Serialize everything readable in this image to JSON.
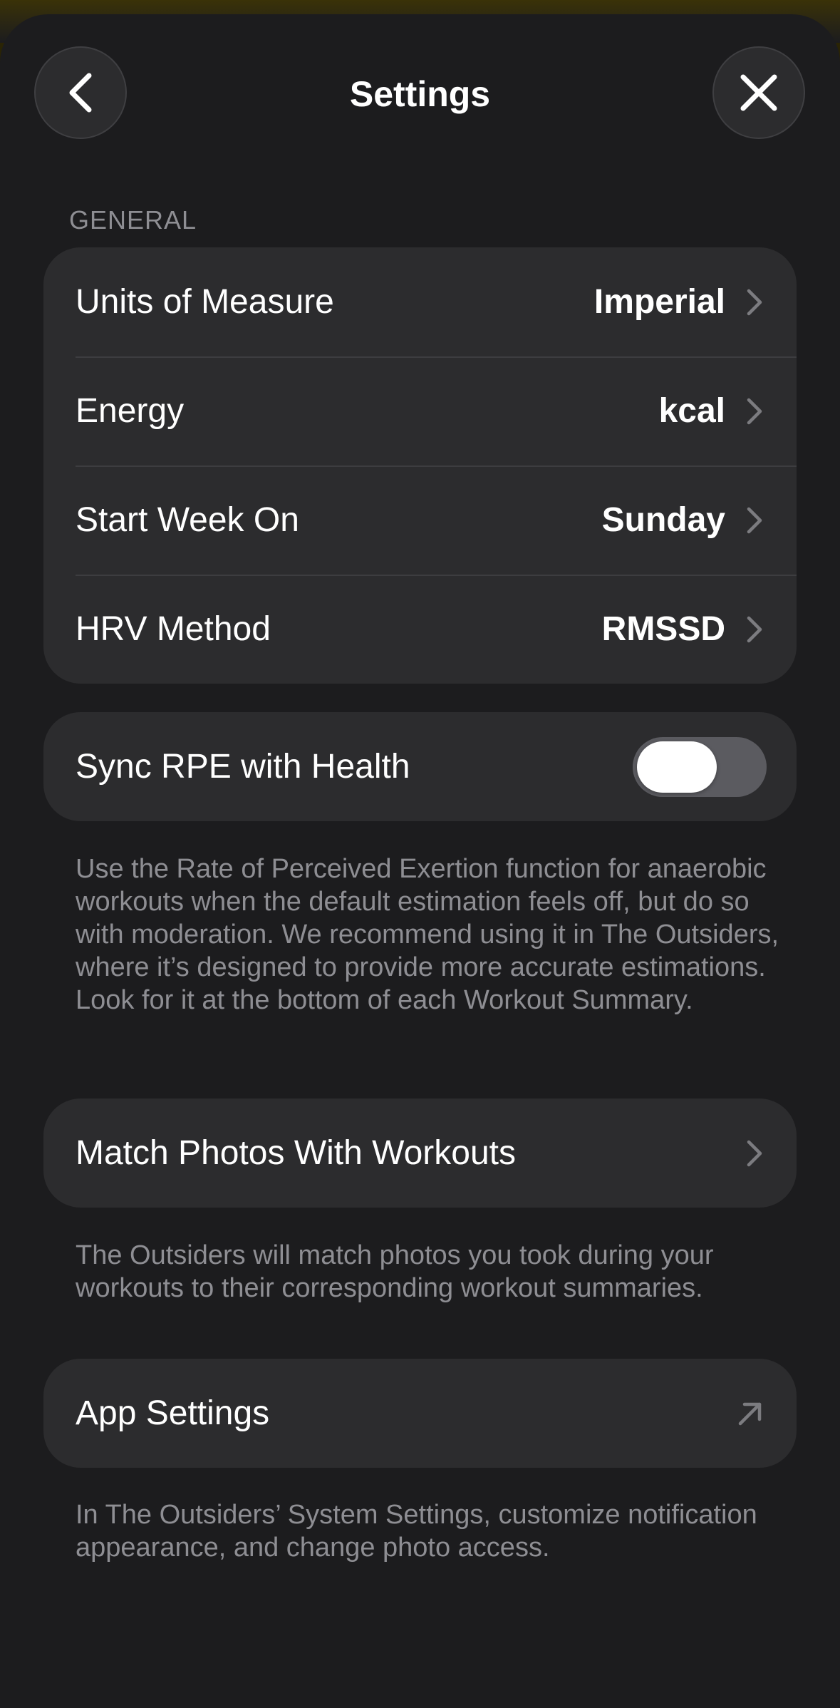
{
  "header": {
    "title": "Settings",
    "back_icon": "chevron-left-icon",
    "close_icon": "close-icon"
  },
  "general": {
    "section_title": "GENERAL",
    "rows": [
      {
        "label": "Units of Measure",
        "value": "Imperial"
      },
      {
        "label": "Energy",
        "value": "kcal"
      },
      {
        "label": "Start Week On",
        "value": "Sunday"
      },
      {
        "label": "HRV Method",
        "value": "RMSSD"
      }
    ]
  },
  "sync_rpe": {
    "label": "Sync RPE with Health",
    "enabled": false,
    "footnote": "Use the Rate of Perceived Exertion function for anaerobic workouts when the default estimation feels off, but do so with moderation. We recommend using it in The Outsiders, where it’s designed to provide more accurate estimations. Look for it at the bottom of each Workout Summary."
  },
  "match_photos": {
    "label": "Match Photos With Workouts",
    "footnote": "The Outsiders will match photos you took during your workouts to their corresponding workout summaries."
  },
  "app_settings": {
    "label": "App Settings",
    "icon": "external-arrow-icon",
    "footnote": "In The Outsiders’ System Settings, customize notification appearance, and change photo access."
  },
  "colors": {
    "background": "#1c1c1e",
    "card": "#2c2c2e",
    "secondary_text": "#8e8e93",
    "toggle_off": "#5b5b60"
  }
}
